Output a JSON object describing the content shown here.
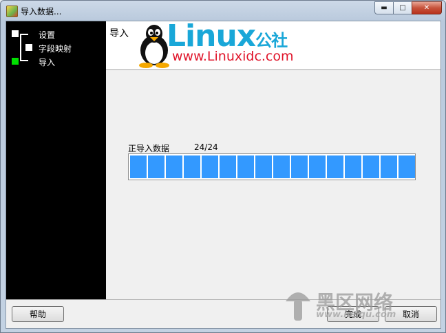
{
  "window": {
    "title": "导入数据..."
  },
  "sidebar": {
    "steps": [
      {
        "label": "设置",
        "state": "done"
      },
      {
        "label": "字段映射",
        "state": "done"
      },
      {
        "label": "导入",
        "state": "active"
      }
    ],
    "active_color": "#00e000"
  },
  "header": {
    "title": "导入",
    "logo_text": "Linux",
    "logo_text_cn": "公社",
    "logo_url": "www.Linuxidc.com"
  },
  "progress": {
    "label": "正导入数据",
    "count": "24/24",
    "fraction": 1.0,
    "color": "#3399ff"
  },
  "footer": {
    "help_label": "帮助",
    "finish_label": "完成",
    "cancel_label": "取消"
  },
  "watermark": {
    "text": "黑区网络",
    "url": "www.heiqu.com"
  }
}
